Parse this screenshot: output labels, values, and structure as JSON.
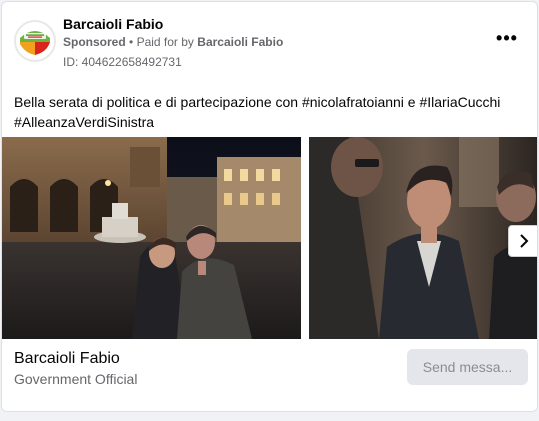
{
  "post": {
    "page_name": "Barcaioli Fabio",
    "sponsored": "Sponsored",
    "separator": "•",
    "paid_for_prefix": "Paid for by",
    "paid_for_name": "Barcaioli Fabio",
    "ad_id": "ID: 404622658492731",
    "more_label": "•••",
    "text_line1": "Bella serata di politica e di partecipazione con #nicolafratoianni e #IlariaCucchi",
    "text_line2": "#AlleanzaVerdiSinistra"
  },
  "footer": {
    "title": "Barcaioli Fabio",
    "subtitle": "Government Official",
    "button_label": "Send messa..."
  },
  "icons": {
    "avatar": "party-logo-avatar",
    "more": "more-options-icon",
    "next": "chevron-right-icon"
  },
  "colors": {
    "text_primary": "#050505",
    "text_secondary": "#65676b",
    "button_bg": "#e4e6eb",
    "button_text": "#8a8d91"
  }
}
